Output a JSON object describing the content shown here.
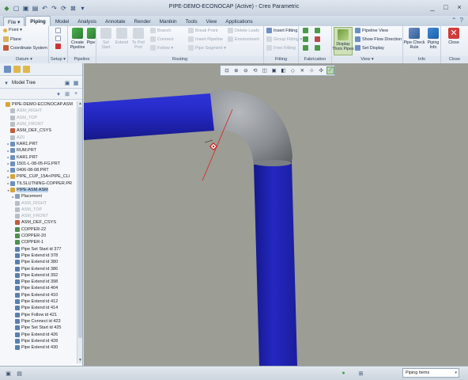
{
  "window": {
    "title": "PIPE-DEMO-ECONOCAP (Active) - Creo Parametric",
    "controls": [
      "_",
      "□",
      "×"
    ]
  },
  "quick_access": [
    "new-icon",
    "open-icon",
    "save-icon",
    "undo-icon",
    "redo-icon",
    "regenerate-icon",
    "close-window-icon",
    "dropdown-icon"
  ],
  "tabs": [
    {
      "label": "File ▾",
      "active": false
    },
    {
      "label": "Piping",
      "active": true
    },
    {
      "label": "Model",
      "active": false
    },
    {
      "label": "Analysis",
      "active": false
    },
    {
      "label": "Annotate",
      "active": false
    },
    {
      "label": "Render",
      "active": false
    },
    {
      "label": "Manikin",
      "active": false
    },
    {
      "label": "Tools",
      "active": false
    },
    {
      "label": "View",
      "active": false
    },
    {
      "label": "Applications",
      "active": false
    }
  ],
  "ribbon": {
    "datum": {
      "label": "Datum ▾",
      "point": "Point ▾",
      "plane": "Plane",
      "csys": "Coordinate System"
    },
    "setup": {
      "label": "Setup ▾"
    },
    "pipeline": {
      "label": "Pipeline",
      "create_pipeline": "Create\nPipeline",
      "pipe": "Pipe"
    },
    "routing": {
      "label": "Routing",
      "set_start": "Set\nStart",
      "extend": "Extend",
      "to_pnt_port": "To Pnt/\nPort",
      "branch": "Branch",
      "connect": "Connect",
      "follow": "Follow ▾",
      "break_point": "Break Point",
      "insert_pipeline": "Insert Pipeline",
      "pipe_segment": "Pipe Segment ▾",
      "delete_leafs": "Delete Leafs",
      "environment": "Environment"
    },
    "fitting": {
      "label": "Fitting",
      "insert_fitting": "Insert Fitting",
      "group_fitting": "Group Fitting ▾",
      "free_fitting": "Free Fitting"
    },
    "fabrication": {
      "label": "Fabrication"
    },
    "view": {
      "label": "View ▾",
      "display_thick_pipes": "Display\nThick Pipes",
      "pipeline_view": "Pipeline View",
      "show_flow_direction": "Show Flow Direction",
      "set_display": "Set Display"
    },
    "info": {
      "label": "Info",
      "pipe_check_rule": "Pipe Check\nRule",
      "piping_info": "Piping\nInfo"
    },
    "close": {
      "label": "Close",
      "close": "Close"
    }
  },
  "model_tree": {
    "header": "Model Tree",
    "items": [
      {
        "label": "PIPE-DEMO-ECONOCAP.ASM",
        "dim": false,
        "depth": 0,
        "arrow": "",
        "icon": "#d8a43a"
      },
      {
        "label": "ASM_RIGHT",
        "dim": true,
        "depth": 1,
        "arrow": "",
        "icon": "#b8bec6"
      },
      {
        "label": "ASM_TOP",
        "dim": true,
        "depth": 1,
        "arrow": "",
        "icon": "#b8bec6"
      },
      {
        "label": "ASM_FRONT",
        "dim": true,
        "depth": 1,
        "arrow": "",
        "icon": "#b8bec6"
      },
      {
        "label": "ASM_DEF_CSYS",
        "dim": false,
        "depth": 1,
        "arrow": "",
        "icon": "#c25b3a"
      },
      {
        "label": "AZ0",
        "dim": true,
        "depth": 1,
        "arrow": "",
        "icon": "#b8bec6"
      },
      {
        "label": "KAR1.PRT",
        "dim": false,
        "depth": 1,
        "arrow": "▸",
        "icon": "#6c8fbf"
      },
      {
        "label": "RUM.PRT",
        "dim": false,
        "depth": 1,
        "arrow": "▸",
        "icon": "#6c8fbf"
      },
      {
        "label": "KAR1.PRT",
        "dim": false,
        "depth": 1,
        "arrow": "▸",
        "icon": "#6c8fbf"
      },
      {
        "label": "1501-L-08-05-FG.PRT",
        "dim": false,
        "depth": 1,
        "arrow": "▸",
        "icon": "#6c8fbf"
      },
      {
        "label": "0406-08-08.PRT",
        "dim": false,
        "depth": 1,
        "arrow": "▸",
        "icon": "#6c8fbf"
      },
      {
        "label": "PIPE_CUP_15A<PIPE_CLI",
        "dim": false,
        "depth": 1,
        "arrow": "▸",
        "icon": "#d8a43a"
      },
      {
        "label": "TILSLUTNING-COPPER.PR",
        "dim": false,
        "depth": 1,
        "arrow": "▸",
        "icon": "#6c8fbf"
      },
      {
        "label": "PIPE-ASM.ASM",
        "dim": false,
        "depth": 1,
        "arrow": "▾",
        "icon": "#d8a43a",
        "selected": true
      },
      {
        "label": "Placement",
        "dim": false,
        "depth": 2,
        "arrow": "▸",
        "icon": "#8a9fb8"
      },
      {
        "label": "ASM_RIGHT",
        "dim": true,
        "depth": 2,
        "arrow": "",
        "icon": "#b8bec6"
      },
      {
        "label": "ASM_TOP",
        "dim": true,
        "depth": 2,
        "arrow": "",
        "icon": "#b8bec6"
      },
      {
        "label": "ASM_FRONT",
        "dim": true,
        "depth": 2,
        "arrow": "",
        "icon": "#b8bec6"
      },
      {
        "label": "ASM_DEF_CSYS",
        "dim": false,
        "depth": 2,
        "arrow": "",
        "icon": "#c25b3a"
      },
      {
        "label": "COPPER-22",
        "dim": false,
        "depth": 2,
        "arrow": "",
        "icon": "#4f8f4f"
      },
      {
        "label": "COPPER-20",
        "dim": false,
        "depth": 2,
        "arrow": "",
        "icon": "#4f8f4f"
      },
      {
        "label": "COPPER-1",
        "dim": false,
        "depth": 2,
        "arrow": "",
        "icon": "#4f8f4f"
      },
      {
        "label": "Pipe Set Start id 377",
        "dim": false,
        "depth": 2,
        "arrow": "",
        "icon": "#5a7fb0"
      },
      {
        "label": "Pipe Extend id 378",
        "dim": false,
        "depth": 2,
        "arrow": "",
        "icon": "#5a7fb0"
      },
      {
        "label": "Pipe Extend id 380",
        "dim": false,
        "depth": 2,
        "arrow": "",
        "icon": "#5a7fb0"
      },
      {
        "label": "Pipe Extend id 386",
        "dim": false,
        "depth": 2,
        "arrow": "",
        "icon": "#5a7fb0"
      },
      {
        "label": "Pipe Extend id 392",
        "dim": false,
        "depth": 2,
        "arrow": "",
        "icon": "#5a7fb0"
      },
      {
        "label": "Pipe Extend id 398",
        "dim": false,
        "depth": 2,
        "arrow": "",
        "icon": "#5a7fb0"
      },
      {
        "label": "Pipe Extend id 404",
        "dim": false,
        "depth": 2,
        "arrow": "",
        "icon": "#5a7fb0"
      },
      {
        "label": "Pipe Extend id 410",
        "dim": false,
        "depth": 2,
        "arrow": "",
        "icon": "#5a7fb0"
      },
      {
        "label": "Pipe Extend id 412",
        "dim": false,
        "depth": 2,
        "arrow": "",
        "icon": "#5a7fb0"
      },
      {
        "label": "Pipe Extend id 414",
        "dim": false,
        "depth": 2,
        "arrow": "",
        "icon": "#5a7fb0"
      },
      {
        "label": "Pipe Follow id 421",
        "dim": false,
        "depth": 2,
        "arrow": "",
        "icon": "#5a7fb0"
      },
      {
        "label": "Pipe Connect id 423",
        "dim": false,
        "depth": 2,
        "arrow": "",
        "icon": "#5a7fb0"
      },
      {
        "label": "Pipe Set Start id 425",
        "dim": false,
        "depth": 2,
        "arrow": "",
        "icon": "#5a7fb0"
      },
      {
        "label": "Pipe Extend id 426",
        "dim": false,
        "depth": 2,
        "arrow": "",
        "icon": "#5a7fb0"
      },
      {
        "label": "Pipe Extend id 428",
        "dim": false,
        "depth": 2,
        "arrow": "",
        "icon": "#5a7fb0"
      },
      {
        "label": "Pipe Extend id 430",
        "dim": false,
        "depth": 2,
        "arrow": "",
        "icon": "#5a7fb0"
      }
    ]
  },
  "graphics_toolbar": [
    "refit-icon",
    "zoom-in-icon",
    "zoom-out-icon",
    "repaint-icon",
    "orient-icon",
    "saved-views-icon",
    "display-style-icon",
    "perspective-icon",
    "datum-display-icon",
    "annotation-display-icon",
    "spin-center-icon",
    "thick-pipes-icon"
  ],
  "status_bar": {
    "filter": "Piping Items",
    "icons": [
      "message-log-icon",
      "find-icon",
      "regenerate-status-icon",
      "selection-icon"
    ]
  },
  "colors": {
    "pipe_blue": "#1f22b8",
    "elbow_gray": "#8e9296",
    "viewport_bg": "#9c9d94",
    "axis_red": "#d42020"
  }
}
